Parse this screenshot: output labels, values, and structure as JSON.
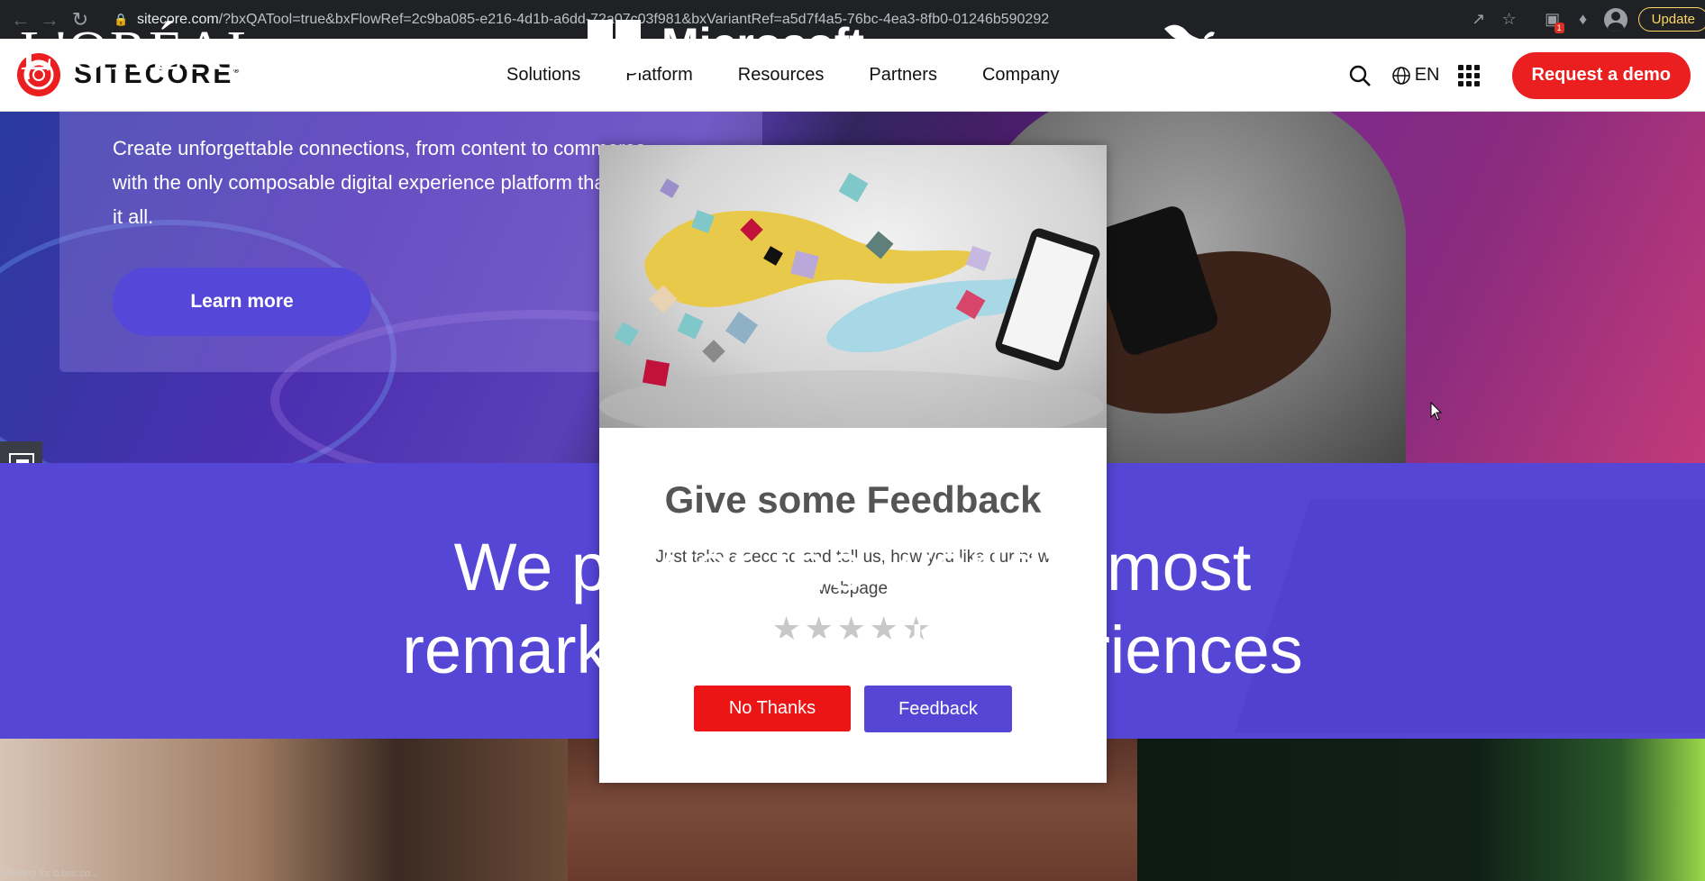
{
  "browser": {
    "url_host": "sitecore.com",
    "url_rest": "/?bxQATool=true&bxFlowRef=2c9ba085-e216-4d1b-a6dd-72a07c03f981&bxVariantRef=a5d7f4a5-76bc-4ea3-8fb0-01246b590292",
    "extension_badge": "1",
    "update_label": "Update"
  },
  "header": {
    "logo_text": "SITECORE",
    "logo_reg": "®",
    "nav": [
      "Solutions",
      "Platform",
      "Resources",
      "Partners",
      "Company"
    ],
    "lang": "EN",
    "cta": "Request a demo"
  },
  "hero": {
    "text": "Create unforgettable connections, from content to commerce, with the only composable digital experience platform that covers it all.",
    "button": "Learn more"
  },
  "band": {
    "line1": "We power the world's most",
    "line2": "remarkable brand experiences"
  },
  "logos": {
    "loreal": "L'ORÉAL",
    "microsoft": "Microsoft"
  },
  "status": {
    "text": "Waiting for b.bsc.co..."
  },
  "modal": {
    "title": "Give some Feedback",
    "subtitle": "Just take a second and tell us, how you like our new webpage",
    "rating": 0,
    "stars_total": 5,
    "no_label": "No Thanks",
    "feedback_label": "Feedback"
  },
  "colors": {
    "brand_red": "#eb1f1f",
    "brand_purple": "#5546d6"
  }
}
